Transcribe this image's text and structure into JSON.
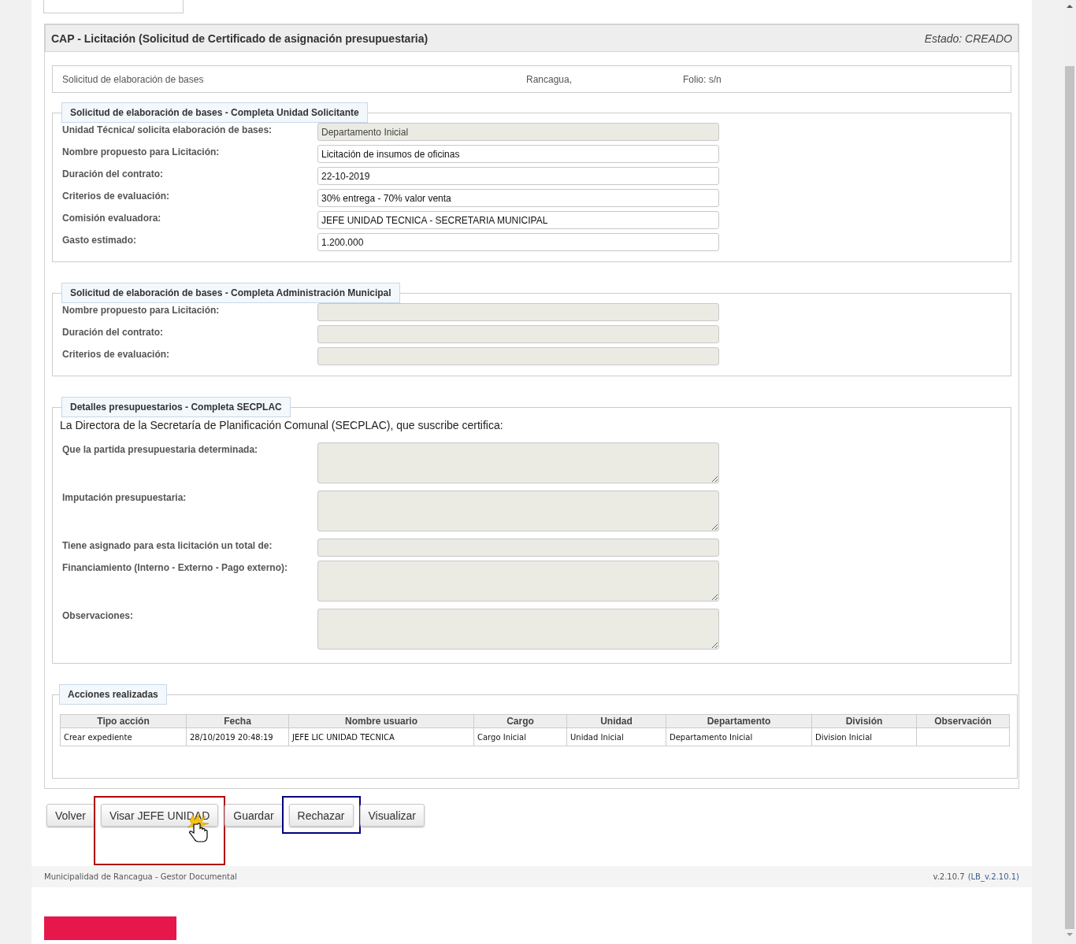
{
  "panel": {
    "title": "CAP - Licitación (Solicitud de Certificado de asignación presupuestaria)",
    "status": "Estado: CREADO"
  },
  "info": {
    "document": "Solicitud de elaboración de bases",
    "city": "Rancagua,",
    "folio": "Folio: s/n"
  },
  "sections": [
    {
      "legend": "Solicitud de elaboración de bases - Completa Unidad Solicitante",
      "fields": [
        {
          "kind": "input",
          "label": "Unidad Técnica/ solicita elaboración de bases:",
          "value": "Departamento Inicial",
          "disabled": true
        },
        {
          "kind": "input",
          "label": "Nombre propuesto para Licitación:",
          "value": "Licitación de insumos de oficinas",
          "disabled": false
        },
        {
          "kind": "input",
          "label": "Duración del contrato:",
          "value": "22-10-2019",
          "disabled": false
        },
        {
          "kind": "input",
          "label": "Criterios de evaluación:",
          "value": "30% entrega - 70% valor venta",
          "disabled": false
        },
        {
          "kind": "input",
          "label": "Comisión evaluadora:",
          "value": "JEFE UNIDAD TECNICA - SECRETARIA MUNICIPAL",
          "disabled": false
        },
        {
          "kind": "input",
          "label": "Gasto estimado:",
          "value": "1.200.000",
          "disabled": false
        }
      ]
    },
    {
      "legend": "Solicitud de elaboración de bases - Completa Administración Municipal",
      "fields": [
        {
          "kind": "input",
          "label": "Nombre propuesto para Licitación:",
          "disabled": true
        },
        {
          "kind": "input",
          "label": "Duración del contrato:",
          "disabled": true
        },
        {
          "kind": "input",
          "label": "Criterios de evaluación:",
          "disabled": true
        }
      ]
    },
    {
      "legend": "Detalles presupuestarios - Completa SECPLAC",
      "intro": "La Directora de la Secretaría de Planificación Comunal (SECPLAC), que suscribe certifica:",
      "fields": [
        {
          "kind": "textarea",
          "label": "Que la partida presupuestaria determinada:",
          "disabled": true
        },
        {
          "kind": "textarea",
          "label": "Imputación presupuestaria:",
          "disabled": true
        },
        {
          "kind": "input",
          "label": "Tiene asignado para esta licitación un total de:",
          "disabled": true
        },
        {
          "kind": "textarea",
          "label": "Financiamiento (Interno - Externo - Pago externo):",
          "disabled": true
        },
        {
          "kind": "textarea",
          "label": "Observaciones:",
          "disabled": true
        }
      ]
    }
  ],
  "actions": {
    "legend": "Acciones realizadas",
    "columns": [
      "Tipo acción",
      "Fecha",
      "Nombre usuario",
      "Cargo",
      "Unidad",
      "Departamento",
      "División",
      "Observación"
    ],
    "rows": [
      [
        "Crear expediente",
        "28/10/2019 20:48:19",
        "JEFE LIC UNIDAD TECNICA",
        "Cargo Inicial",
        "Unidad Inicial",
        "Departamento Inicial",
        "Division Inicial",
        ""
      ]
    ]
  },
  "buttons": [
    {
      "label": "Volver"
    },
    {
      "label": "Visar JEFE UNIDAD",
      "color": "#b00010",
      "cursor": true
    },
    {
      "label": "Guardar"
    },
    {
      "label": "Rechazar",
      "color": "#000080"
    },
    {
      "label": "Visualizar"
    }
  ],
  "footer": {
    "left": "Municipalidad de Rancagua - Gestor Documental",
    "version": "v.2.10.7",
    "build": "(LB_v.2.10.1)"
  }
}
